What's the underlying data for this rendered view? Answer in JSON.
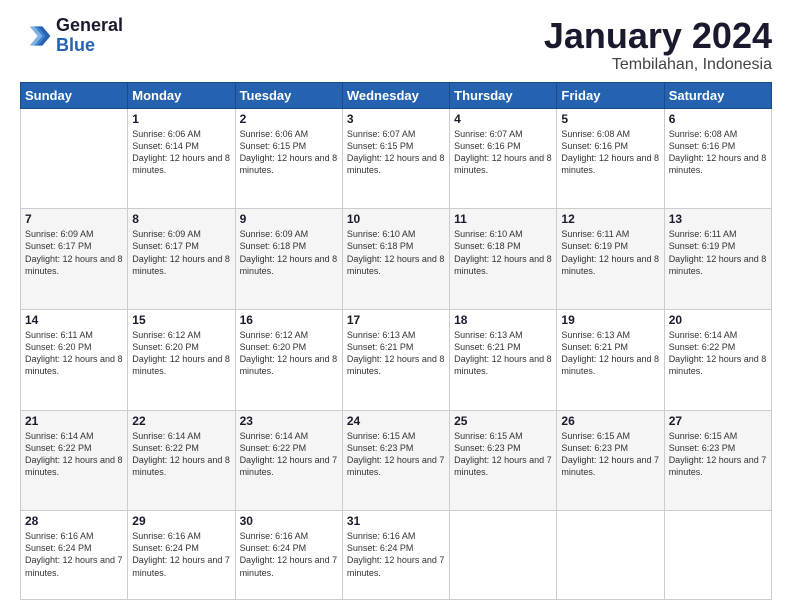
{
  "header": {
    "logo_line1": "General",
    "logo_line2": "Blue",
    "title": "January 2024",
    "subtitle": "Tembilahan, Indonesia"
  },
  "weekdays": [
    "Sunday",
    "Monday",
    "Tuesday",
    "Wednesday",
    "Thursday",
    "Friday",
    "Saturday"
  ],
  "weeks": [
    [
      null,
      {
        "day": "1",
        "sunrise": "6:06 AM",
        "sunset": "6:14 PM",
        "daylight": "12 hours and 8 minutes."
      },
      {
        "day": "2",
        "sunrise": "6:06 AM",
        "sunset": "6:15 PM",
        "daylight": "12 hours and 8 minutes."
      },
      {
        "day": "3",
        "sunrise": "6:07 AM",
        "sunset": "6:15 PM",
        "daylight": "12 hours and 8 minutes."
      },
      {
        "day": "4",
        "sunrise": "6:07 AM",
        "sunset": "6:16 PM",
        "daylight": "12 hours and 8 minutes."
      },
      {
        "day": "5",
        "sunrise": "6:08 AM",
        "sunset": "6:16 PM",
        "daylight": "12 hours and 8 minutes."
      },
      {
        "day": "6",
        "sunrise": "6:08 AM",
        "sunset": "6:16 PM",
        "daylight": "12 hours and 8 minutes."
      }
    ],
    [
      {
        "day": "7",
        "sunrise": "6:09 AM",
        "sunset": "6:17 PM",
        "daylight": "12 hours and 8 minutes."
      },
      {
        "day": "8",
        "sunrise": "6:09 AM",
        "sunset": "6:17 PM",
        "daylight": "12 hours and 8 minutes."
      },
      {
        "day": "9",
        "sunrise": "6:09 AM",
        "sunset": "6:18 PM",
        "daylight": "12 hours and 8 minutes."
      },
      {
        "day": "10",
        "sunrise": "6:10 AM",
        "sunset": "6:18 PM",
        "daylight": "12 hours and 8 minutes."
      },
      {
        "day": "11",
        "sunrise": "6:10 AM",
        "sunset": "6:18 PM",
        "daylight": "12 hours and 8 minutes."
      },
      {
        "day": "12",
        "sunrise": "6:11 AM",
        "sunset": "6:19 PM",
        "daylight": "12 hours and 8 minutes."
      },
      {
        "day": "13",
        "sunrise": "6:11 AM",
        "sunset": "6:19 PM",
        "daylight": "12 hours and 8 minutes."
      }
    ],
    [
      {
        "day": "14",
        "sunrise": "6:11 AM",
        "sunset": "6:20 PM",
        "daylight": "12 hours and 8 minutes."
      },
      {
        "day": "15",
        "sunrise": "6:12 AM",
        "sunset": "6:20 PM",
        "daylight": "12 hours and 8 minutes."
      },
      {
        "day": "16",
        "sunrise": "6:12 AM",
        "sunset": "6:20 PM",
        "daylight": "12 hours and 8 minutes."
      },
      {
        "day": "17",
        "sunrise": "6:13 AM",
        "sunset": "6:21 PM",
        "daylight": "12 hours and 8 minutes."
      },
      {
        "day": "18",
        "sunrise": "6:13 AM",
        "sunset": "6:21 PM",
        "daylight": "12 hours and 8 minutes."
      },
      {
        "day": "19",
        "sunrise": "6:13 AM",
        "sunset": "6:21 PM",
        "daylight": "12 hours and 8 minutes."
      },
      {
        "day": "20",
        "sunrise": "6:14 AM",
        "sunset": "6:22 PM",
        "daylight": "12 hours and 8 minutes."
      }
    ],
    [
      {
        "day": "21",
        "sunrise": "6:14 AM",
        "sunset": "6:22 PM",
        "daylight": "12 hours and 8 minutes."
      },
      {
        "day": "22",
        "sunrise": "6:14 AM",
        "sunset": "6:22 PM",
        "daylight": "12 hours and 8 minutes."
      },
      {
        "day": "23",
        "sunrise": "6:14 AM",
        "sunset": "6:22 PM",
        "daylight": "12 hours and 7 minutes."
      },
      {
        "day": "24",
        "sunrise": "6:15 AM",
        "sunset": "6:23 PM",
        "daylight": "12 hours and 7 minutes."
      },
      {
        "day": "25",
        "sunrise": "6:15 AM",
        "sunset": "6:23 PM",
        "daylight": "12 hours and 7 minutes."
      },
      {
        "day": "26",
        "sunrise": "6:15 AM",
        "sunset": "6:23 PM",
        "daylight": "12 hours and 7 minutes."
      },
      {
        "day": "27",
        "sunrise": "6:15 AM",
        "sunset": "6:23 PM",
        "daylight": "12 hours and 7 minutes."
      }
    ],
    [
      {
        "day": "28",
        "sunrise": "6:16 AM",
        "sunset": "6:24 PM",
        "daylight": "12 hours and 7 minutes."
      },
      {
        "day": "29",
        "sunrise": "6:16 AM",
        "sunset": "6:24 PM",
        "daylight": "12 hours and 7 minutes."
      },
      {
        "day": "30",
        "sunrise": "6:16 AM",
        "sunset": "6:24 PM",
        "daylight": "12 hours and 7 minutes."
      },
      {
        "day": "31",
        "sunrise": "6:16 AM",
        "sunset": "6:24 PM",
        "daylight": "12 hours and 7 minutes."
      },
      null,
      null,
      null
    ]
  ]
}
